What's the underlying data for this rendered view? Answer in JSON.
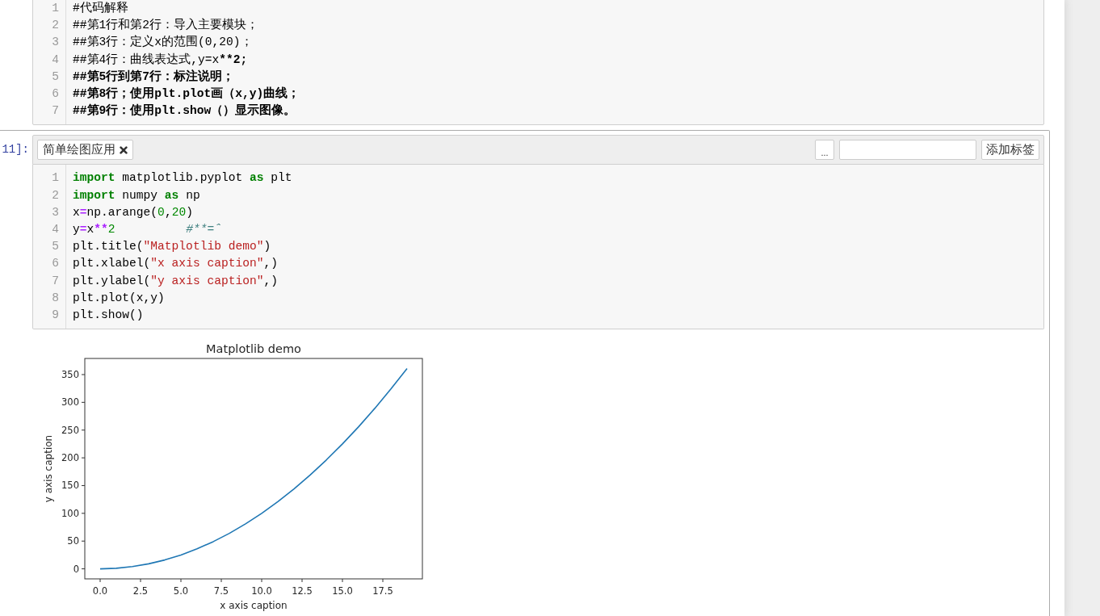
{
  "notebook": {
    "cells": [
      {
        "selected": false,
        "lines": [
          {
            "number": "1",
            "tokens": [
              {
                "kind": "text",
                "text": "#代码解释"
              }
            ]
          },
          {
            "number": "2",
            "tokens": [
              {
                "kind": "text",
                "text": "##第1行和第2行：导入主要模块；"
              }
            ]
          },
          {
            "number": "3",
            "tokens": [
              {
                "kind": "text",
                "text": "##第3行：定义x的范围(0,20)；"
              }
            ]
          },
          {
            "number": "4",
            "tokens": [
              {
                "kind": "text",
                "text": "##第4行：曲线表达式,y=x"
              },
              {
                "kind": "strong",
                "text": "**2;"
              }
            ]
          },
          {
            "number": "5",
            "tokens": [
              {
                "kind": "strong",
                "text": "##第5行到第7行：标注说明；"
              }
            ]
          },
          {
            "number": "6",
            "tokens": [
              {
                "kind": "strong",
                "text": "##第8行；使用plt.plot画（x,y)曲线；"
              }
            ]
          },
          {
            "number": "7",
            "tokens": [
              {
                "kind": "strong",
                "text": "##第9行：使用plt.show（）显示图像。"
              }
            ]
          }
        ]
      },
      {
        "selected": true,
        "prompt": "11]:",
        "tag_toolbar": {
          "tags": [
            {
              "label": "简单绘图应用"
            }
          ],
          "more_button": "...",
          "add_button": "添加标签"
        },
        "lines": [
          {
            "number": "1",
            "tokens": [
              {
                "kind": "keyword",
                "text": "import"
              },
              {
                "kind": "text",
                "text": " matplotlib.pyplot "
              },
              {
                "kind": "keyword",
                "text": "as"
              },
              {
                "kind": "text",
                "text": " plt"
              }
            ]
          },
          {
            "number": "2",
            "tokens": [
              {
                "kind": "keyword",
                "text": "import"
              },
              {
                "kind": "text",
                "text": " numpy "
              },
              {
                "kind": "keyword",
                "text": "as"
              },
              {
                "kind": "text",
                "text": " np"
              }
            ]
          },
          {
            "number": "3",
            "tokens": [
              {
                "kind": "text",
                "text": "x"
              },
              {
                "kind": "operator",
                "text": "="
              },
              {
                "kind": "text",
                "text": "np.arange("
              },
              {
                "kind": "number",
                "text": "0"
              },
              {
                "kind": "text",
                "text": ","
              },
              {
                "kind": "number",
                "text": "20"
              },
              {
                "kind": "text",
                "text": ")"
              }
            ]
          },
          {
            "number": "4",
            "tokens": [
              {
                "kind": "text",
                "text": "y"
              },
              {
                "kind": "operator",
                "text": "="
              },
              {
                "kind": "text",
                "text": "x"
              },
              {
                "kind": "operator",
                "text": "**"
              },
              {
                "kind": "number",
                "text": "2"
              },
              {
                "kind": "comment",
                "text": "          #**=ˆ"
              }
            ]
          },
          {
            "number": "5",
            "tokens": [
              {
                "kind": "text",
                "text": "plt.title("
              },
              {
                "kind": "string",
                "text": "\"Matplotlib demo\""
              },
              {
                "kind": "text",
                "text": ")"
              }
            ]
          },
          {
            "number": "6",
            "tokens": [
              {
                "kind": "text",
                "text": "plt.xlabel("
              },
              {
                "kind": "string",
                "text": "\"x axis caption\""
              },
              {
                "kind": "text",
                "text": ",)"
              }
            ]
          },
          {
            "number": "7",
            "tokens": [
              {
                "kind": "text",
                "text": "plt.ylabel("
              },
              {
                "kind": "string",
                "text": "\"y axis caption\""
              },
              {
                "kind": "text",
                "text": ",)"
              }
            ]
          },
          {
            "number": "8",
            "tokens": [
              {
                "kind": "text",
                "text": "plt.plot(x,y)"
              }
            ]
          },
          {
            "number": "9",
            "tokens": [
              {
                "kind": "text",
                "text": "plt.show()"
              }
            ]
          }
        ],
        "output": {
          "chart_data": {
            "type": "line",
            "title": "Matplotlib demo",
            "xlabel": "x axis caption",
            "ylabel": "y axis caption",
            "x": [
              0,
              1,
              2,
              3,
              4,
              5,
              6,
              7,
              8,
              9,
              10,
              11,
              12,
              13,
              14,
              15,
              16,
              17,
              18,
              19
            ],
            "values": [
              0,
              1,
              4,
              9,
              16,
              25,
              36,
              49,
              64,
              81,
              100,
              121,
              144,
              169,
              196,
              225,
              256,
              289,
              324,
              361
            ],
            "xlim": [
              -0.95,
              19.95
            ],
            "ylim": [
              -18.05,
              379.05
            ],
            "xticks": [
              {
                "value": 0,
                "label": "0.0"
              },
              {
                "value": 2.5,
                "label": "2.5"
              },
              {
                "value": 5,
                "label": "5.0"
              },
              {
                "value": 7.5,
                "label": "7.5"
              },
              {
                "value": 10,
                "label": "10.0"
              },
              {
                "value": 12.5,
                "label": "12.5"
              },
              {
                "value": 15,
                "label": "15.0"
              },
              {
                "value": 17.5,
                "label": "17.5"
              }
            ],
            "yticks": [
              0,
              50,
              100,
              150,
              200,
              250,
              300,
              350
            ]
          }
        }
      }
    ]
  }
}
